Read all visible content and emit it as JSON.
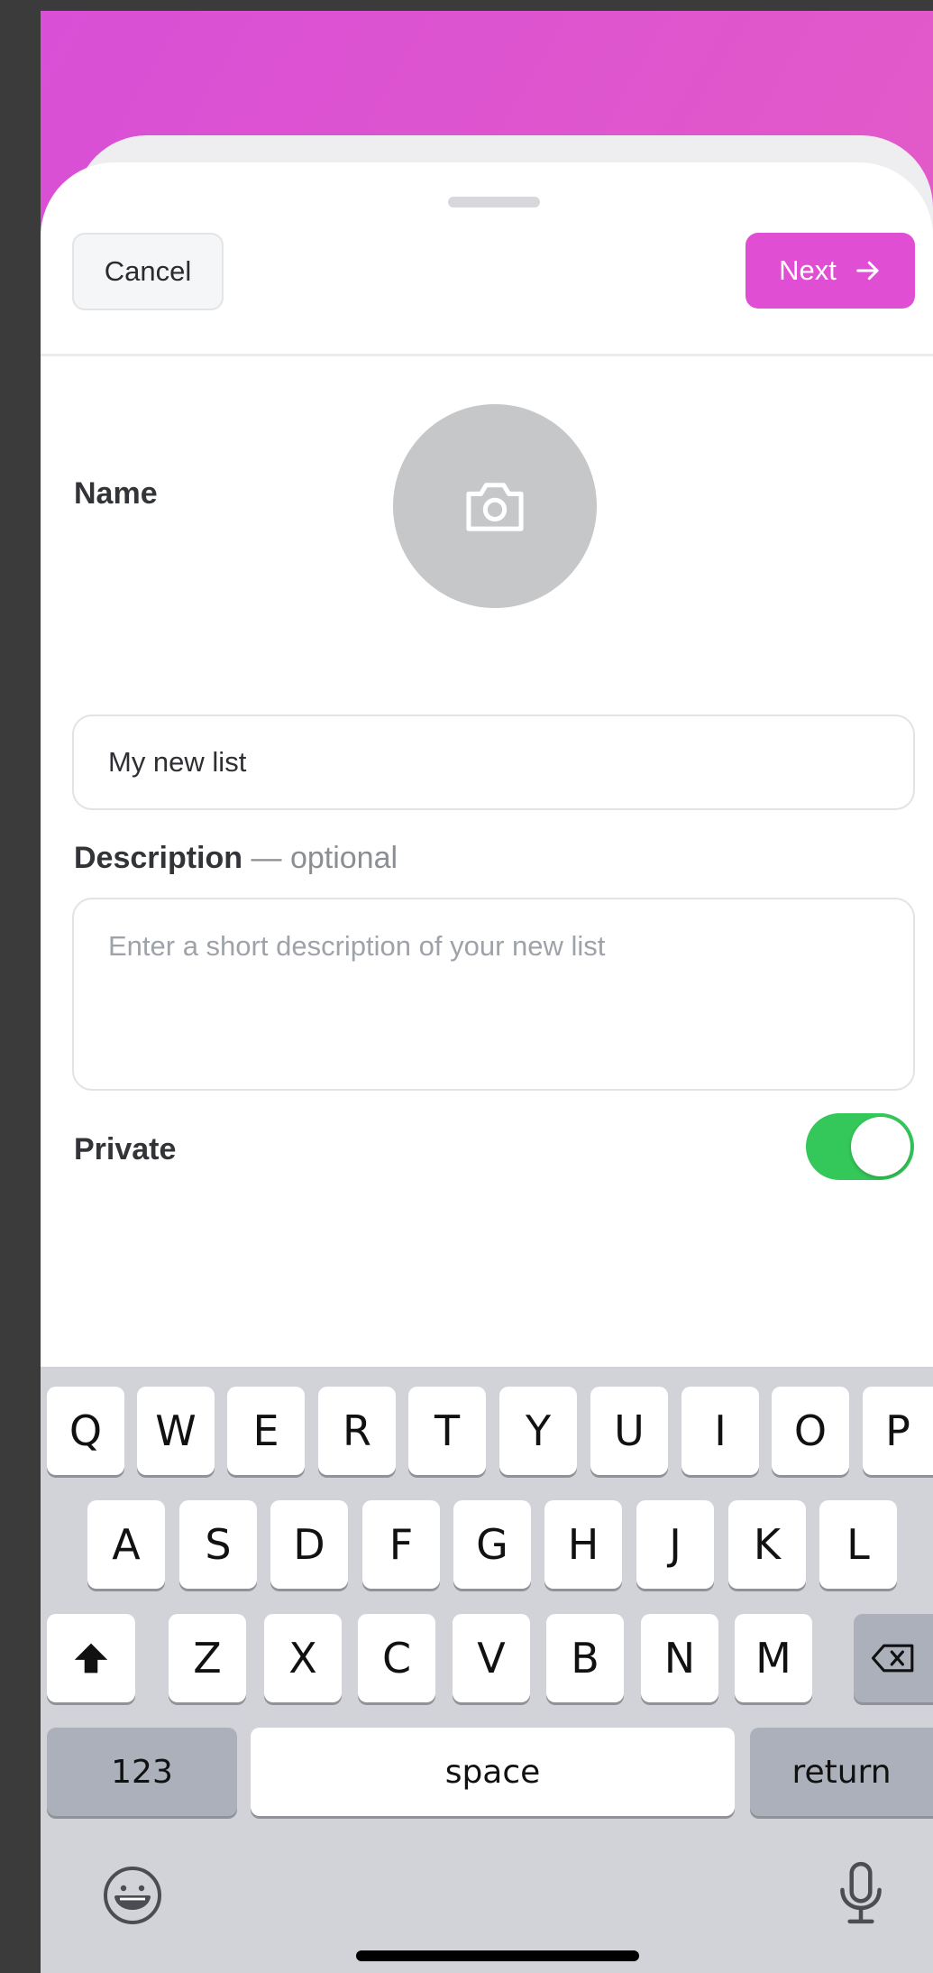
{
  "header": {
    "cancel_label": "Cancel",
    "next_label": "Next"
  },
  "form": {
    "name_label": "Name",
    "name_value": "My new list",
    "description_label": "Description",
    "description_optional": "— optional",
    "description_placeholder": "Enter a short description of your new list",
    "private_label": "Private",
    "private_enabled": true
  },
  "keyboard": {
    "row1": [
      "Q",
      "W",
      "E",
      "R",
      "T",
      "Y",
      "U",
      "I",
      "O",
      "P"
    ],
    "row2": [
      "A",
      "S",
      "D",
      "F",
      "G",
      "H",
      "J",
      "K",
      "L"
    ],
    "row3": [
      "Z",
      "X",
      "C",
      "V",
      "B",
      "N",
      "M"
    ],
    "numbers_label": "123",
    "space_label": "space",
    "return_label": "return"
  },
  "icons": {
    "avatar": "camera-icon",
    "next": "arrow-right-icon",
    "shift": "shift-icon",
    "delete": "backspace-icon",
    "emoji": "emoji-icon",
    "mic": "microphone-icon"
  },
  "colors": {
    "accent": "#e04fd3",
    "toggle_on": "#34c759"
  }
}
